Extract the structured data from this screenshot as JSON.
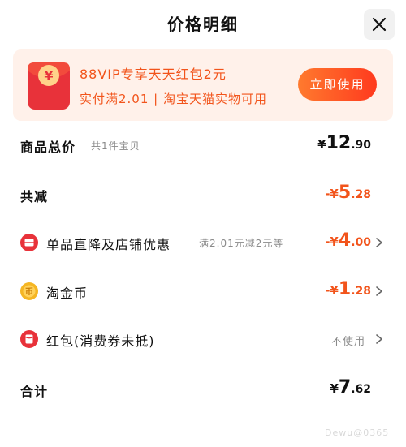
{
  "header": {
    "title": "价格明细"
  },
  "banner": {
    "line1": "88VIP专享天天红包2元",
    "line2": "实付满2.01 | 淘宝天猫实物可用",
    "button_label": "立即使用",
    "packet_symbol": "¥"
  },
  "rows": {
    "total_price": {
      "label": "商品总价",
      "sub": "共1件宝贝",
      "currency": "¥",
      "int": "12",
      "dec": ".90"
    },
    "total_reduction": {
      "label": "共减",
      "currency": "-¥",
      "int": "5",
      "dec": ".28"
    },
    "store_discount": {
      "label": "单品直降及店铺优惠",
      "sub": "满2.01元减2元等",
      "currency": "-¥",
      "int": "4",
      "dec": ".00"
    },
    "taojinbi": {
      "label": "淘金币",
      "currency": "-¥",
      "int": "1",
      "dec": ".28"
    },
    "red_packet": {
      "label": "红包(消费券未抵)",
      "status": "不使用"
    },
    "grand_total": {
      "label": "合计",
      "currency": "¥",
      "int": "7",
      "dec": ".62"
    }
  },
  "watermark": "Dewu@0365",
  "colors": {
    "accent": "#f2541b",
    "banner_bg": "#fff1ea",
    "icon_red": "#e8323a",
    "coin_gold": "#f5b623"
  },
  "icons": [
    "close-icon",
    "red-packet-icon",
    "discount-icon",
    "coin-icon",
    "coupon-icon",
    "chevron-right-icon"
  ]
}
